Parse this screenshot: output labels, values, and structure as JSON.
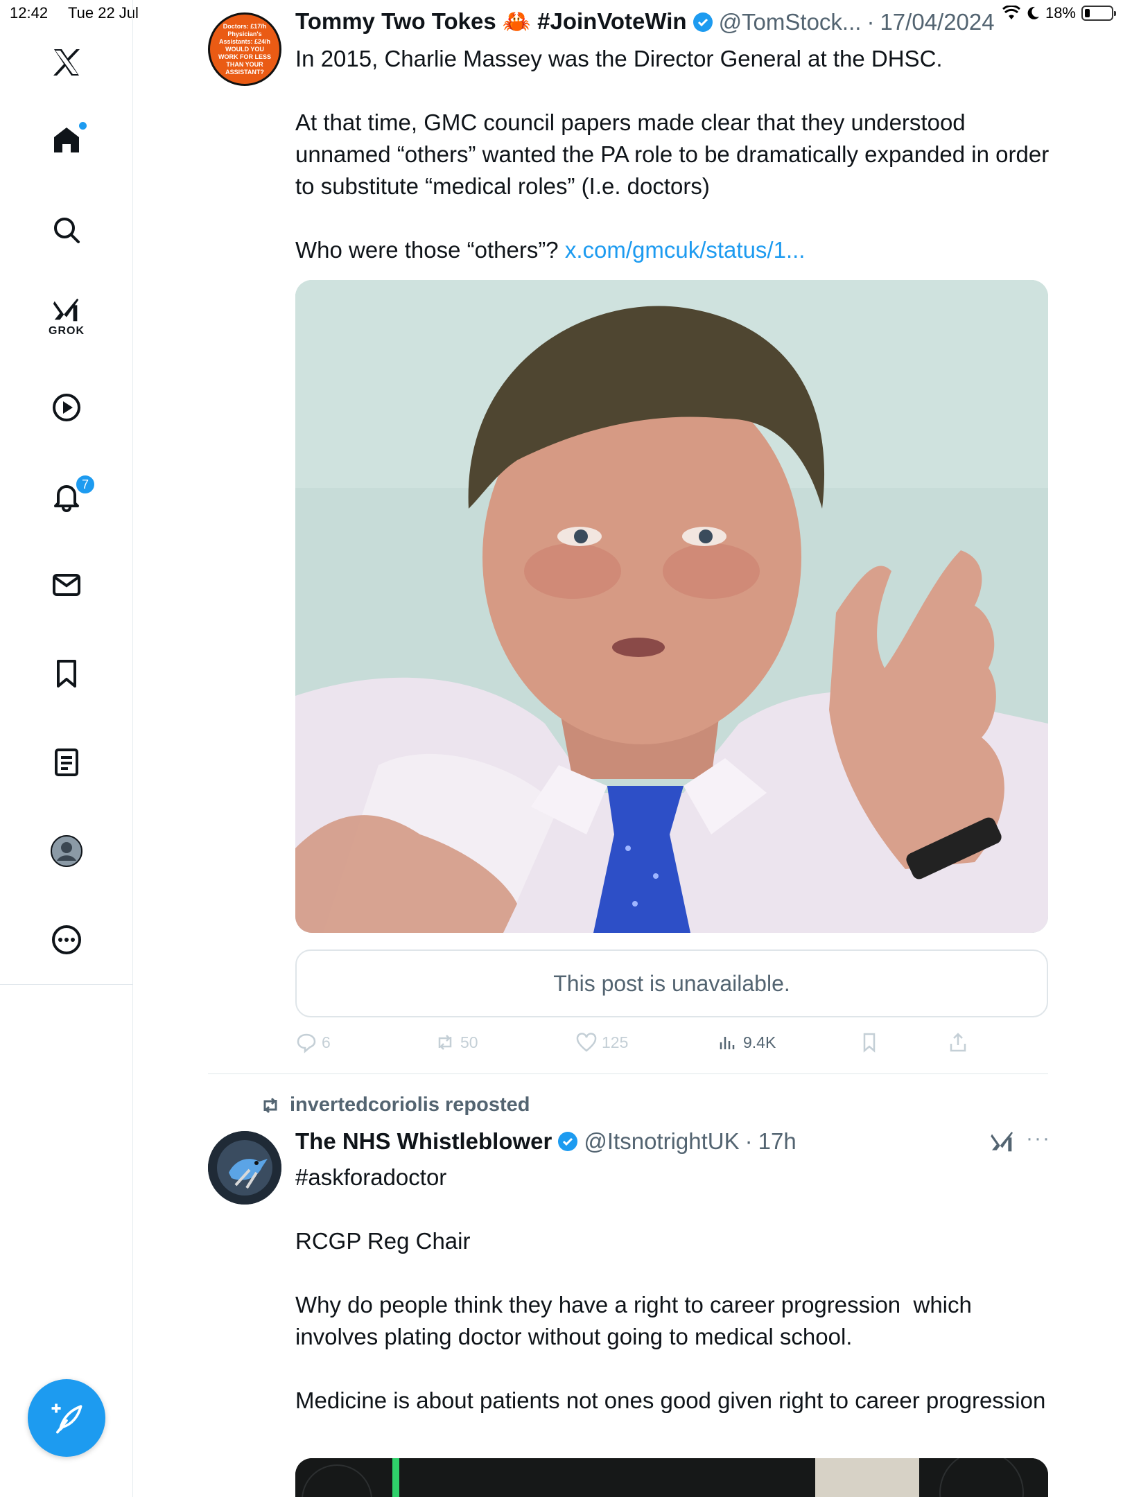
{
  "status_bar": {
    "time": "12:42",
    "date": "Tue 22 Jul",
    "battery": "18%"
  },
  "sidebar": {
    "items": [
      {
        "icon": "x-logo-icon"
      },
      {
        "icon": "home-icon"
      },
      {
        "icon": "search-icon"
      },
      {
        "icon": "grok-icon",
        "label": "GROK"
      },
      {
        "icon": "video-play-icon"
      },
      {
        "icon": "bell-icon",
        "badge": "7"
      },
      {
        "icon": "mail-icon"
      },
      {
        "icon": "bookmark-icon"
      },
      {
        "icon": "list-icon"
      },
      {
        "icon": "profile-avatar-icon"
      },
      {
        "icon": "more-icon"
      }
    ],
    "compose_icon": "compose-feather-icon"
  },
  "post1": {
    "avatar_text": "Doctors: £17/h Physician's Assistants: £24/h WOULD YOU WORK FOR LESS THAN YOUR ASSISTANT?",
    "display_name": "Tommy Two Tokes 🦀 #JoinVoteWin",
    "handle": "@TomStock...",
    "sep": "·",
    "date": "17/04/2024",
    "text_main": "In 2015, Charlie Massey was the Director General at the DHSC.\n\nAt that time, GMC council papers made clear that they understood unnamed “others” wanted the PA role to be dramatically expanded in order to substitute “medical roles” (I.e. doctors)\n\nWho were those “others”? ",
    "link": "x.com/gmcuk/status/1...",
    "unavailable": "This post is unavailable.",
    "actions": {
      "replies": "6",
      "reposts": "50",
      "likes": "125",
      "views": "9.4K"
    }
  },
  "post2": {
    "repost_by": "invertedcoriolis reposted",
    "display_name": "The NHS Whistleblower",
    "handle": "@ItsnotrightUK",
    "sep": "·",
    "time": "17h",
    "more": "···",
    "text": "#askforadoctor\n\nRCGP Reg Chair\n\nWhy do people think they have a right to career progression  which involves plating doctor without going to medical school.\n\nMedicine is about patients not ones good given right to career progression"
  },
  "colors": {
    "accent": "#1d9bf0",
    "text": "#0f1419",
    "muted": "#536471"
  }
}
